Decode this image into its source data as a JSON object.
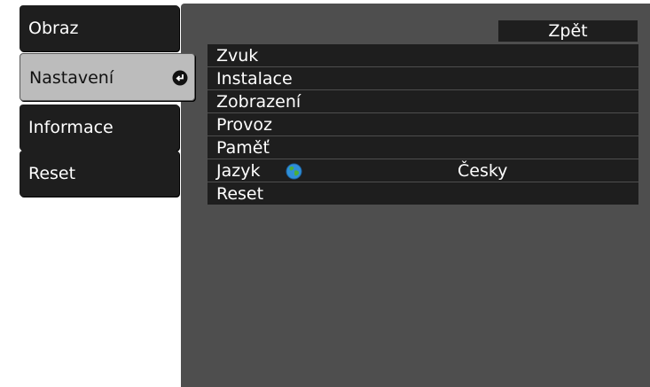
{
  "tabs": [
    {
      "label": "Obraz"
    },
    {
      "label": "Nastavení"
    },
    {
      "label": "Informace"
    },
    {
      "label": "Reset"
    }
  ],
  "panel": {
    "back_label": "Zpět",
    "items": [
      {
        "label": "Zvuk"
      },
      {
        "label": "Instalace"
      },
      {
        "label": "Zobrazení"
      },
      {
        "label": "Provoz"
      },
      {
        "label": "Paměť"
      },
      {
        "label": "Jazyk",
        "value": "Česky",
        "icon": "globe-icon"
      },
      {
        "label": "Reset"
      }
    ]
  },
  "colors": {
    "tab_bg": "#1e1e1e",
    "tab_active_bg": "#bcbcbc",
    "panel_bg": "#4e4e4e",
    "row_bg": "#1e1e1e",
    "text": "#ffffff"
  }
}
